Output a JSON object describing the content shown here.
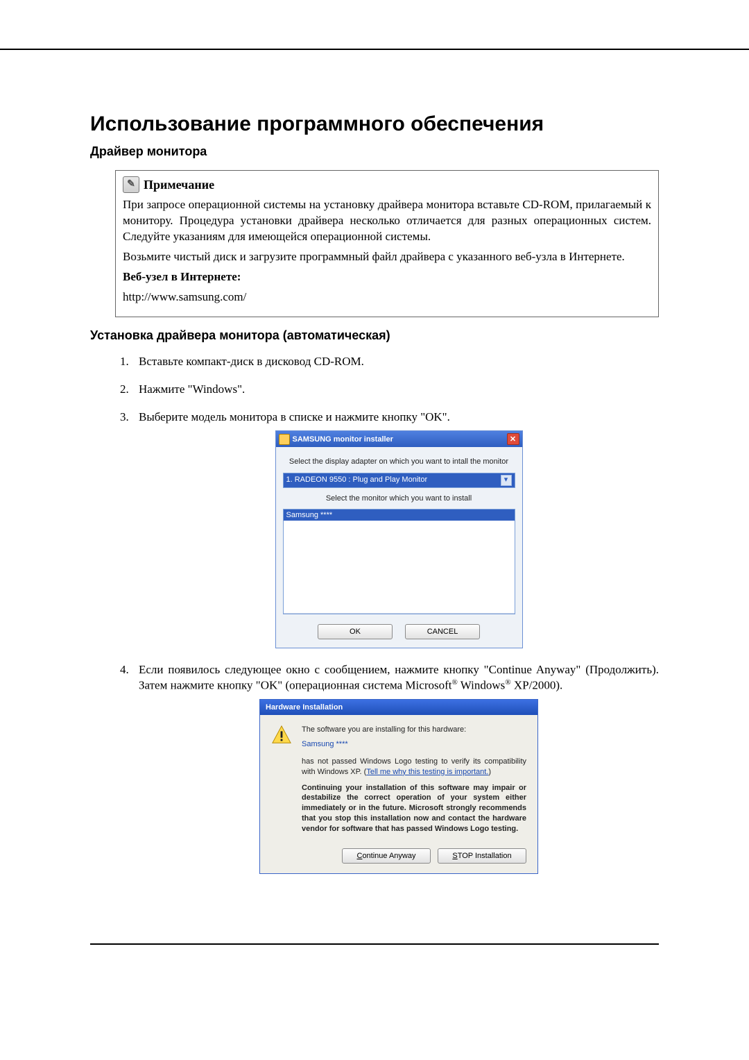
{
  "page": {
    "title": "Использование программного обеспечения",
    "section1": "Драйвер монитора",
    "section2": "Установка драйвера монитора (автоматическая)"
  },
  "note": {
    "label": "Примечание",
    "p1": "При запросе операционной системы на установку драйвера монитора вставьте CD-ROM, прилагаемый к монитору. Процедура установки драйвера несколько отличается для разных операционных систем. Следуйте указаниям для имеющейся операционной системы.",
    "p2": "Возьмите чистый диск и загрузите программный файл драйвера с указанного веб-узла в Интернете.",
    "weblabel": "Веб-узел в Интернете:",
    "url": "http://www.samsung.com/"
  },
  "steps": {
    "s1": "Вставьте компакт-диск в дисковод CD-ROM.",
    "s2": "Нажмите \"Windows\".",
    "s3": "Выберите модель монитора в списке и нажмите кнопку \"OK\".",
    "s4a": "Если появилось следующее окно с сообщением, нажмите кнопку \"Continue Anyway\" (Продолжить). Затем нажмите кнопку \"OK\" (операционная система Microsoft",
    "s4b": " Windows",
    "s4c": " XP/2000)."
  },
  "dlg1": {
    "title": "SAMSUNG monitor installer",
    "line1": "Select the display adapter on which you want to intall the monitor",
    "combo": "1. RADEON 9550 : Plug and Play Monitor",
    "line2": "Select the monitor which you want to install",
    "list_sel": "Samsung ****",
    "ok": "OK",
    "cancel": "CANCEL"
  },
  "dlg2": {
    "title": "Hardware Installation",
    "line1": "The software you are installing for this hardware:",
    "hw": "Samsung ****",
    "line2a": "has not passed Windows Logo testing to verify its compatibility with Windows XP. (",
    "link": "Tell me why this testing is important.",
    "line2b": ")",
    "bold": "Continuing your installation of this software may impair or destabilize the correct operation of your system either immediately or in the future. Microsoft strongly recommends that you stop this installation now and contact the hardware vendor for software that has passed Windows Logo testing.",
    "btn_continue": "Continue Anyway",
    "btn_stop": "STOP Installation"
  }
}
